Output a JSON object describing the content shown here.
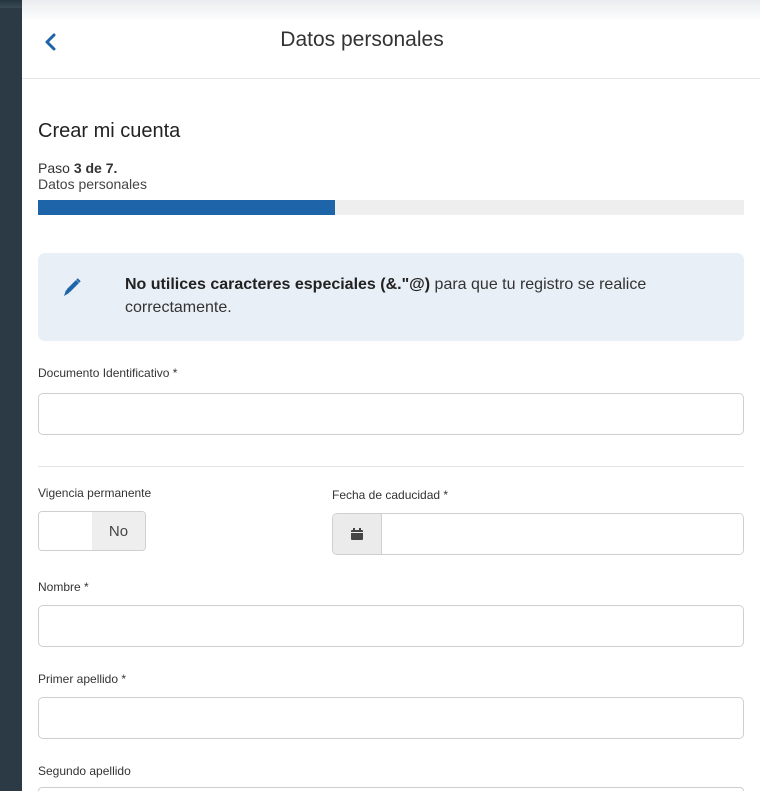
{
  "header": {
    "title": "Datos personales",
    "back_icon": "chevron-left-icon"
  },
  "form": {
    "heading": "Crear mi cuenta",
    "step": {
      "prefix": "Paso ",
      "current_of_total": "3 de 7.",
      "subtitle": "Datos personales",
      "progress_fraction": 0.42
    },
    "notice": {
      "icon": "pencil-icon",
      "bold_text": "No utilices caracteres especiales (&.\"@)",
      "rest_text": " para que tu registro se realice correctamente."
    },
    "fields": {
      "document_label": "Documento Identificativo *",
      "document_value": "",
      "vigencia_label": "Vigencia permanente",
      "vigencia_state": "No",
      "expiry_label": "Fecha de caducidad *",
      "expiry_icon": "calendar-icon",
      "expiry_value": "",
      "nombre_label": "Nombre *",
      "nombre_value": "",
      "apellido1_label": "Primer apellido *",
      "apellido1_value": "",
      "apellido2_label": "Segundo apellido"
    }
  },
  "colors": {
    "accent": "#1e64a8",
    "notice_bg": "#e8eff6",
    "backdrop": "#2b3a44"
  }
}
